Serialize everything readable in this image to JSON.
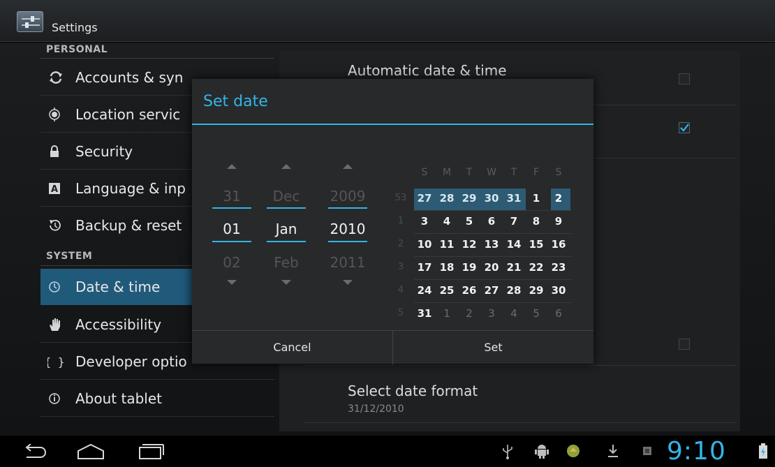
{
  "action_bar": {
    "title": "Settings"
  },
  "nav": {
    "personal_header": "PERSONAL",
    "system_header": "SYSTEM",
    "items": [
      {
        "label": "Accounts & syn",
        "icon": "sync-icon"
      },
      {
        "label": "Location servic",
        "icon": "location-icon"
      },
      {
        "label": "Security",
        "icon": "lock-icon"
      },
      {
        "label": "Language & inp",
        "icon": "language-icon"
      },
      {
        "label": "Backup & reset",
        "icon": "backup-icon"
      },
      {
        "label": "Date & time",
        "icon": "clock-icon",
        "selected": true
      },
      {
        "label": "Accessibility",
        "icon": "hand-icon"
      },
      {
        "label": "Developer optio",
        "icon": "braces-icon"
      },
      {
        "label": "About tablet",
        "icon": "info-icon"
      }
    ]
  },
  "prefs": {
    "automatic_date_time": {
      "title": "Automatic date & time",
      "checked": false
    },
    "select_date_format": {
      "title": "Select date format",
      "summary": "31/12/2010"
    }
  },
  "dialog": {
    "title": "Set date",
    "day": {
      "prev": "31",
      "current": "01",
      "next": "02"
    },
    "month": {
      "prev": "Dec",
      "current": "Jan",
      "next": "Feb"
    },
    "year": {
      "prev": "2009",
      "current": "2010",
      "next": "2011"
    },
    "calendar": {
      "weekdays": [
        "S",
        "M",
        "T",
        "W",
        "T",
        "F",
        "S"
      ],
      "weeks": [
        {
          "num": "53",
          "days": [
            "27",
            "28",
            "29",
            "30",
            "31",
            "1",
            "2"
          ]
        },
        {
          "num": "1",
          "days": [
            "3",
            "4",
            "5",
            "6",
            "7",
            "8",
            "9"
          ]
        },
        {
          "num": "2",
          "days": [
            "10",
            "11",
            "12",
            "13",
            "14",
            "15",
            "16"
          ]
        },
        {
          "num": "3",
          "days": [
            "17",
            "18",
            "19",
            "20",
            "21",
            "22",
            "23"
          ]
        },
        {
          "num": "4",
          "days": [
            "24",
            "25",
            "26",
            "27",
            "28",
            "29",
            "30"
          ]
        },
        {
          "num": "5",
          "days": [
            "31",
            "1",
            "2",
            "3",
            "4",
            "5",
            "6"
          ]
        }
      ]
    },
    "cancel_label": "Cancel",
    "set_label": "Set"
  },
  "system_bar": {
    "clock": "9:10",
    "icons": [
      "back-icon",
      "home-icon",
      "recent-apps-icon",
      "usb-icon",
      "android-debug-icon",
      "app-notification-icon",
      "download-icon",
      "sd-card-icon",
      "battery-icon"
    ]
  },
  "colors": {
    "accent": "#33b5e5",
    "selected_nav": "#205a7a",
    "calendar_highlight": "#2d5b74"
  }
}
